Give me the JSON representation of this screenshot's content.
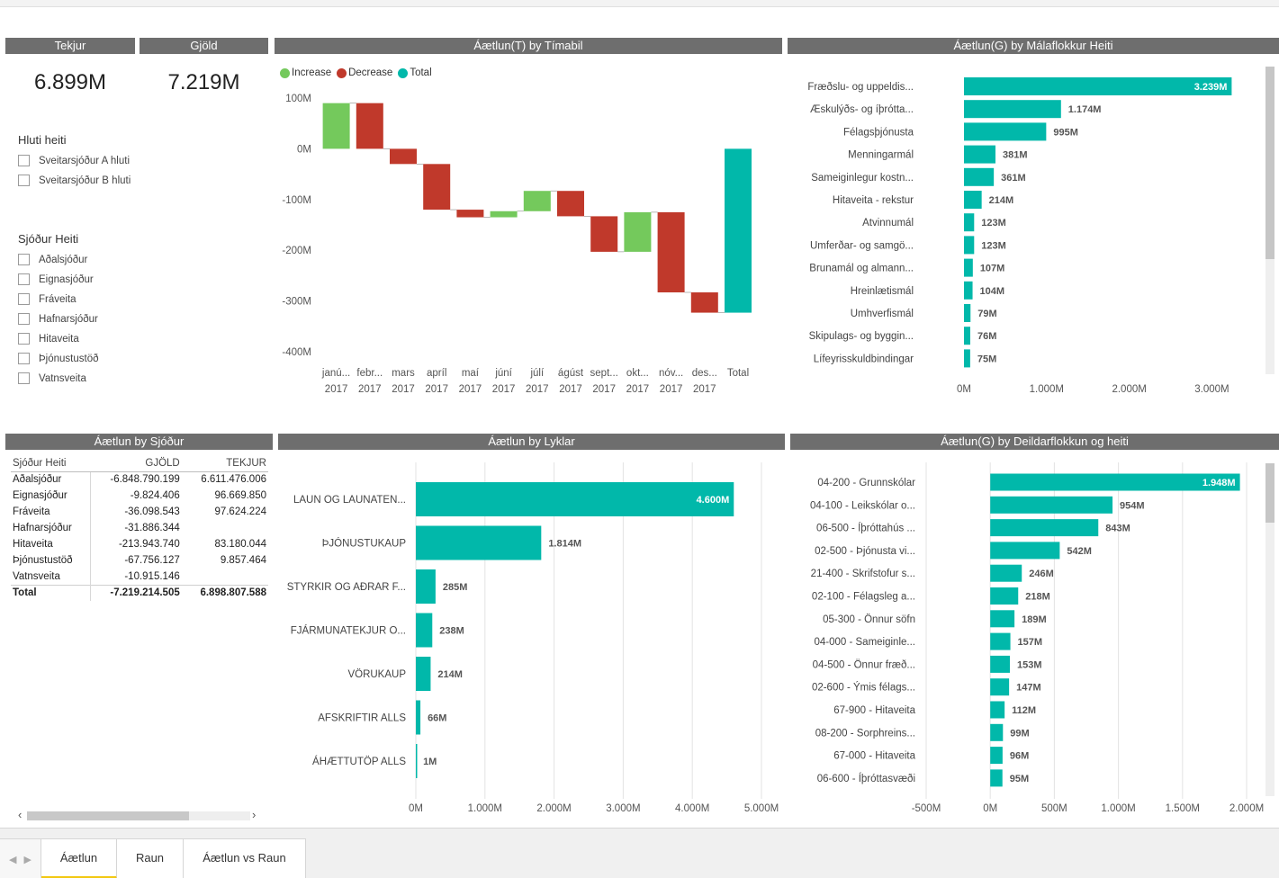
{
  "kpis": [
    {
      "title": "Tekjur",
      "value": "6.899M"
    },
    {
      "title": "Gjöld",
      "value": "7.219M"
    }
  ],
  "slicers": [
    {
      "title": "Hluti heiti",
      "items": [
        "Sveitarsjóður A hluti",
        "Sveitarsjóður B hluti"
      ]
    },
    {
      "title": "Sjóður Heiti",
      "items": [
        "Aðalsjóður",
        "Eignasjóður",
        "Fráveita",
        "Hafnarsjóður",
        "Hitaveita",
        "Þjónustustöð",
        "Vatnsveita"
      ]
    }
  ],
  "visuals": {
    "waterfall_title": "Áætlun(T) by Tímabil",
    "malaflokkur_title": "Áætlun(G) by Málaflokkur Heiti",
    "sjodur_table_title": "Áætlun by Sjóður",
    "lyklar_title": "Áætlun by Lyklar",
    "deild_title": "Áætlun(G) by Deildarflokkun og heiti"
  },
  "table": {
    "headers": [
      "Sjóður Heiti",
      "GJÖLD",
      "TEKJUR"
    ],
    "rows": [
      [
        "Aðalsjóður",
        "-6.848.790.199",
        "6.611.476.006"
      ],
      [
        "Eignasjóður",
        "-9.824.406",
        "96.669.850"
      ],
      [
        "Fráveita",
        "-36.098.543",
        "97.624.224"
      ],
      [
        "Hafnarsjóður",
        "-31.886.344",
        ""
      ],
      [
        "Hitaveita",
        "-213.943.740",
        "83.180.044"
      ],
      [
        "Þjónustustöð",
        "-67.756.127",
        "9.857.464"
      ],
      [
        "Vatnsveita",
        "-10.915.146",
        ""
      ]
    ],
    "total": [
      "Total",
      "-7.219.214.505",
      "6.898.807.588"
    ]
  },
  "tabs": [
    "Áætlun",
    "Raun",
    "Áætlun vs Raun"
  ],
  "active_tab": "Áætlun",
  "colors": {
    "teal": "#01b8aa",
    "increase": "#74c95c",
    "decrease": "#c0392b",
    "header": "#6e6e6e",
    "active_tab": "#f2c811"
  },
  "chart_data": [
    {
      "type": "waterfall",
      "title": "Áætlun(T) by Tímabil",
      "legend": [
        "Increase",
        "Decrease",
        "Total"
      ],
      "legend_position": "top-left",
      "categories": [
        [
          "janú...",
          "2017"
        ],
        [
          "febr...",
          "2017"
        ],
        [
          "mars",
          "2017"
        ],
        [
          "apríl",
          "2017"
        ],
        [
          "maí",
          "2017"
        ],
        [
          "júní",
          "2017"
        ],
        [
          "júlí",
          "2017"
        ],
        [
          "ágúst",
          "2017"
        ],
        [
          "sept...",
          "2017"
        ],
        [
          "okt...",
          "2017"
        ],
        [
          "nóv...",
          "2017"
        ],
        [
          "des...",
          "2017"
        ],
        [
          "Total",
          ""
        ]
      ],
      "values": [
        90,
        -90,
        -30,
        -90,
        -15,
        12,
        40,
        -50,
        -70,
        78,
        -158,
        -40,
        -323
      ],
      "y_ticks": [
        "100M",
        "0M",
        "-100M",
        "-200M",
        "-300M",
        "-400M"
      ],
      "ylim": [
        -400,
        100
      ],
      "units": "M"
    },
    {
      "type": "bar",
      "orientation": "horizontal",
      "title": "Áætlun(G) by Málaflokkur Heiti",
      "categories": [
        "Fræðslu- og uppeldis...",
        "Æskulýðs- og íþrótta...",
        "Félagsþjónusta",
        "Menningarmál",
        "Sameiginlegur kostn...",
        "Hitaveita - rekstur",
        "Atvinnumál",
        "Umferðar- og samgö...",
        "Brunamál og almann...",
        "Hreinlætismál",
        "Umhverfismál",
        "Skipulags- og byggin...",
        "Lífeyrisskuldbindingar"
      ],
      "values": [
        3239,
        1174,
        995,
        381,
        361,
        214,
        123,
        123,
        107,
        104,
        79,
        76,
        75
      ],
      "labels": [
        "3.239M",
        "1.174M",
        "995M",
        "381M",
        "361M",
        "214M",
        "123M",
        "123M",
        "107M",
        "104M",
        "79M",
        "76M",
        "75M"
      ],
      "x_ticks": [
        "0M",
        "1.000M",
        "2.000M",
        "3.000M"
      ],
      "xlim": [
        0,
        3300
      ]
    },
    {
      "type": "bar",
      "orientation": "horizontal",
      "title": "Áætlun by Lyklar",
      "categories": [
        "LAUN OG LAUNATEN...",
        "ÞJÓNUSTUKAUP",
        "STYRKIR OG AÐRAR F...",
        "FJÁRMUNATEKJUR O...",
        "VÖRUKAUP",
        "AFSKRIFTIR ALLS",
        "ÁHÆTTUTÖP ALLS"
      ],
      "values": [
        4600,
        1814,
        285,
        238,
        214,
        66,
        1
      ],
      "labels": [
        "4.600M",
        "1.814M",
        "285M",
        "238M",
        "214M",
        "66M",
        "1M"
      ],
      "x_ticks": [
        "0M",
        "1.000M",
        "2.000M",
        "3.000M",
        "4.000M",
        "5.000M"
      ],
      "xlim": [
        0,
        5000
      ]
    },
    {
      "type": "bar",
      "orientation": "horizontal",
      "title": "Áætlun(G) by Deildarflokkun og heiti",
      "categories": [
        "04-200 - Grunnskólar",
        "04-100 - Leikskólar o...",
        "06-500 - Íþróttahús ...",
        "02-500 - Þjónusta vi...",
        "21-400 - Skrifstofur s...",
        "02-100 - Félagsleg a...",
        "05-300 - Önnur söfn",
        "04-000 - Sameiginle...",
        "04-500 - Önnur fræð...",
        "02-600 - Ýmis félags...",
        "67-900 - Hitaveita",
        "08-200 - Sorphreins...",
        "67-000 - Hitaveita",
        "06-600 - Íþróttasvæði"
      ],
      "values": [
        1948,
        954,
        843,
        542,
        246,
        218,
        189,
        157,
        153,
        147,
        112,
        99,
        96,
        95
      ],
      "labels": [
        "1.948M",
        "954M",
        "843M",
        "542M",
        "246M",
        "218M",
        "189M",
        "157M",
        "153M",
        "147M",
        "112M",
        "99M",
        "96M",
        "95M"
      ],
      "x_ticks": [
        "-500M",
        "0M",
        "500M",
        "1.000M",
        "1.500M",
        "2.000M"
      ],
      "xlim": [
        -500,
        2000
      ]
    }
  ]
}
